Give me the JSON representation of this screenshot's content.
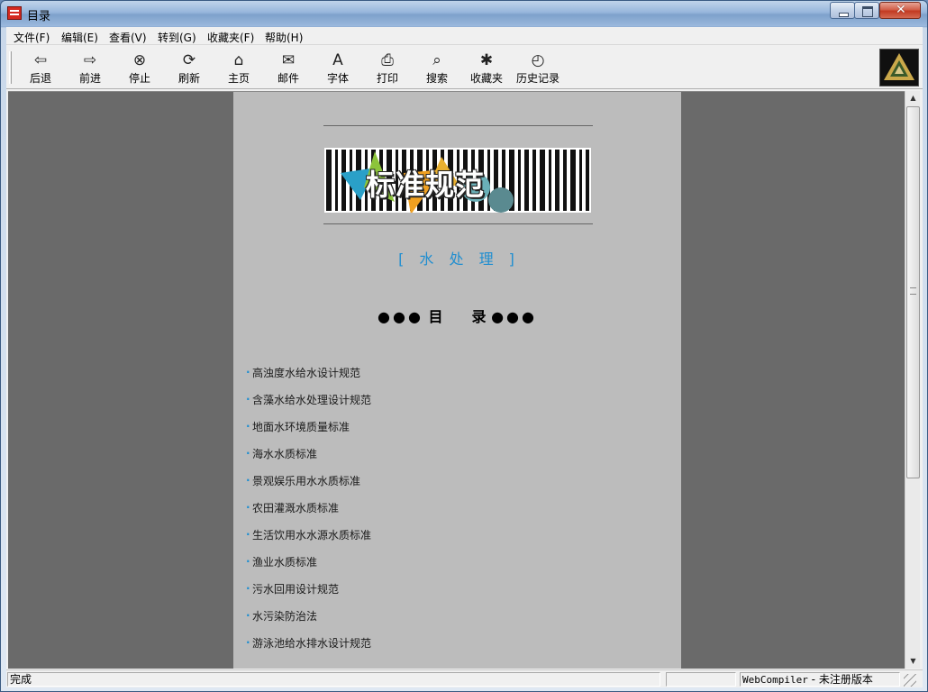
{
  "window": {
    "title": "目录"
  },
  "menu": [
    "文件(F)",
    "编辑(E)",
    "查看(V)",
    "转到(G)",
    "收藏夹(F)",
    "帮助(H)"
  ],
  "toolbar": [
    {
      "label": "后退",
      "icon": "back-arrow-icon",
      "glyph": "⇦"
    },
    {
      "label": "前进",
      "icon": "forward-arrow-icon",
      "glyph": "⇨"
    },
    {
      "label": "停止",
      "icon": "stop-icon",
      "glyph": "⊗"
    },
    {
      "label": "刷新",
      "icon": "refresh-icon",
      "glyph": "⟳"
    },
    {
      "label": "主页",
      "icon": "home-icon",
      "glyph": "⌂"
    },
    {
      "label": "邮件",
      "icon": "mail-icon",
      "glyph": "✉"
    },
    {
      "label": "字体",
      "icon": "font-icon",
      "glyph": "A"
    },
    {
      "label": "打印",
      "icon": "print-icon",
      "glyph": "⎙"
    },
    {
      "label": "搜索",
      "icon": "search-icon",
      "glyph": "⌕"
    },
    {
      "label": "收藏夹",
      "icon": "favorites-icon",
      "glyph": "✱"
    },
    {
      "label": "历史记录",
      "icon": "history-icon",
      "glyph": "◴"
    }
  ],
  "page": {
    "banner_title": "标准规范",
    "subtitle": "[ 水 处 理 ]",
    "toc_heading": "目　　录",
    "toc_dots": "●●●",
    "items": [
      "高浊度水给水设计规范",
      "含藻水给水处理设计规范",
      "地面水环境质量标准",
      "海水水质标准",
      "景观娱乐用水水质标准",
      "农田灌溉水质标准",
      "生活饮用水水源水质标准",
      "渔业水质标准",
      "污水回用设计规范",
      "水污染防治法",
      "游泳池给水排水设计规范"
    ]
  },
  "status": {
    "text": "完成",
    "version_mono": "WebCompiler",
    "version_rest": " - 未注册版本"
  },
  "colors": {
    "accent": "#1f8ed0",
    "page_bg": "#bcbcbc",
    "viewport_bg": "#6a6a6a"
  }
}
